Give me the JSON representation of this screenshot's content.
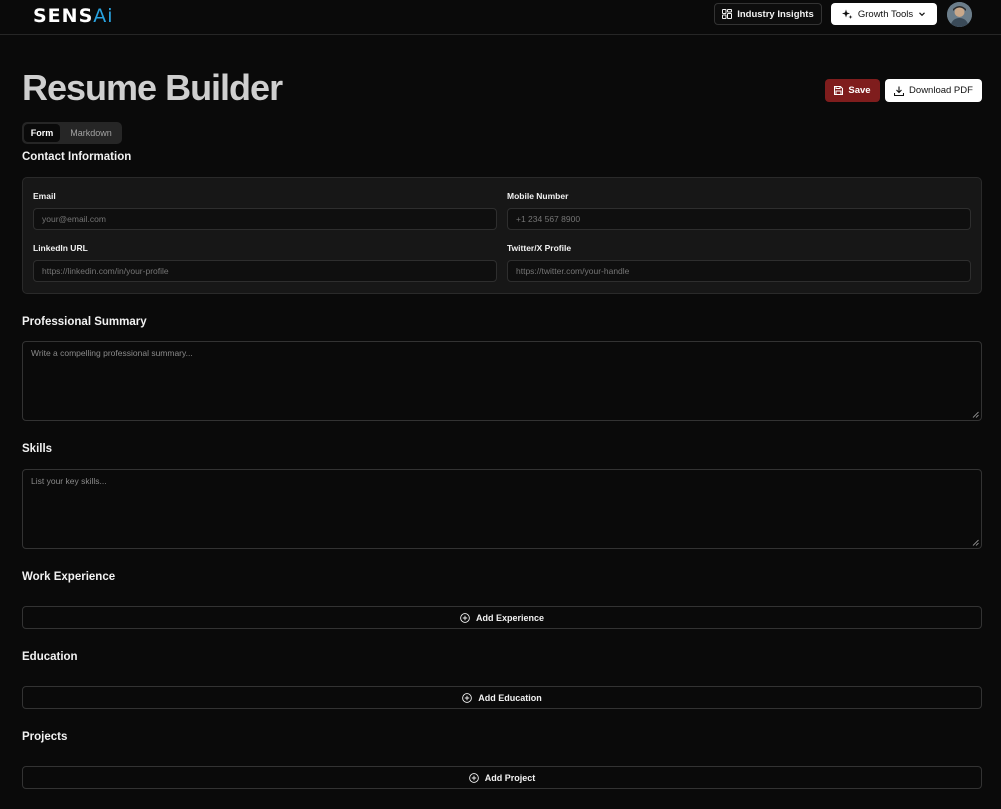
{
  "header": {
    "logo_main": "SENS",
    "logo_accent": "Ai",
    "industry_insights_label": "Industry Insights",
    "growth_tools_label": "Growth Tools"
  },
  "page": {
    "title": "Resume Builder",
    "save_label": "Save",
    "download_label": "Download PDF",
    "tabs": [
      "Form",
      "Markdown"
    ],
    "active_tab": "Form"
  },
  "contact": {
    "heading": "Contact Information",
    "email_label": "Email",
    "email_placeholder": "your@email.com",
    "mobile_label": "Mobile Number",
    "mobile_placeholder": "+1 234 567 8900",
    "linkedin_label": "LinkedIn URL",
    "linkedin_placeholder": "https://linkedin.com/in/your-profile",
    "twitter_label": "Twitter/X Profile",
    "twitter_placeholder": "https://twitter.com/your-handle"
  },
  "summary": {
    "heading": "Professional Summary",
    "placeholder": "Write a compelling professional summary..."
  },
  "skills": {
    "heading": "Skills",
    "placeholder": "List your key skills..."
  },
  "experience": {
    "heading": "Work Experience",
    "add_label": "Add Experience"
  },
  "education": {
    "heading": "Education",
    "add_label": "Add Education"
  },
  "projects": {
    "heading": "Projects",
    "add_label": "Add Project"
  },
  "colors": {
    "background": "#0a0a0a",
    "save_button": "#7f1d1d",
    "logo_accent": "#29a3e0"
  }
}
